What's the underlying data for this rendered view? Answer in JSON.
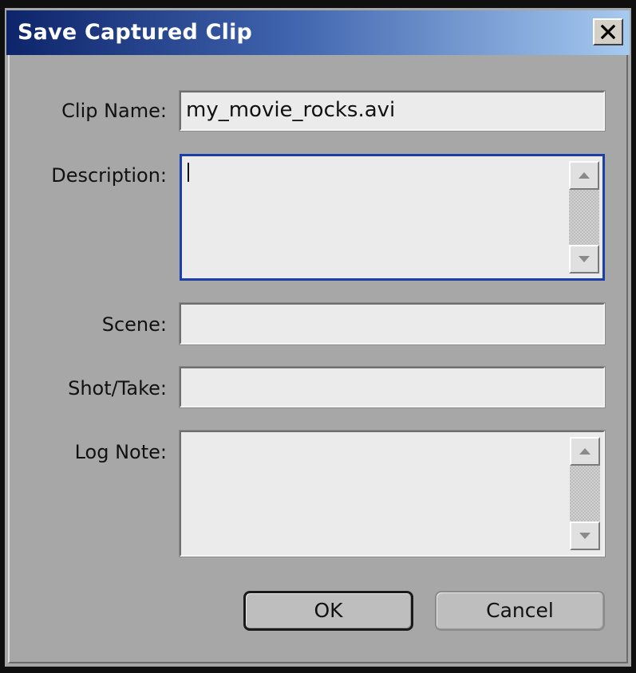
{
  "window": {
    "title": "Save Captured Clip",
    "close_icon": "close-icon"
  },
  "form": {
    "clip_name": {
      "label": "Clip Name:",
      "value": "my_movie_rocks.avi"
    },
    "description": {
      "label": "Description:",
      "value": ""
    },
    "scene": {
      "label": "Scene:",
      "value": ""
    },
    "shot_take": {
      "label": "Shot/Take:",
      "value": ""
    },
    "log_note": {
      "label": "Log Note:",
      "value": ""
    }
  },
  "buttons": {
    "ok_label": "OK",
    "cancel_label": "Cancel"
  },
  "colors": {
    "title_gradient_start": "#0d246a",
    "title_gradient_end": "#a6caf0",
    "dialog_background": "#a7a7a7",
    "focus_border": "#1c3ea8"
  }
}
